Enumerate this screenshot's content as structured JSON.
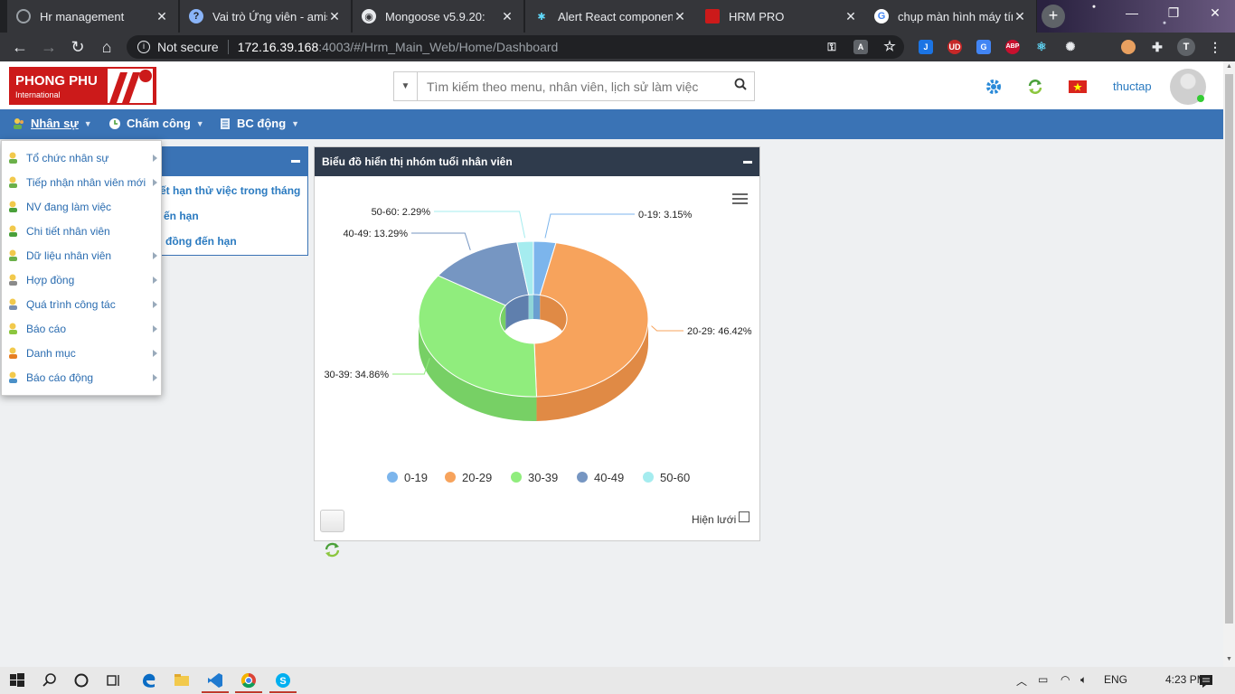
{
  "browser": {
    "tabs": [
      {
        "title": "Hr management",
        "icon": "loading-icon"
      },
      {
        "title": "Vai trò Ứng viên - amis",
        "icon": "help-icon"
      },
      {
        "title": "Mongoose v5.9.20:",
        "icon": "globe-icon"
      },
      {
        "title": "Alert React componen",
        "icon": "react-icon"
      },
      {
        "title": "HRM PRO",
        "icon": "hrm-icon"
      },
      {
        "title": "chụp màn hình máy tính",
        "icon": "google-icon"
      }
    ],
    "address": {
      "security": "Not secure",
      "host": "172.16.39.168",
      "path": ":4003/#/Hrm_Main_Web/Home/Dashboard"
    },
    "profile_initial": "T"
  },
  "app": {
    "logo": {
      "line1": "PHONG PHU",
      "line2": "International"
    },
    "search": {
      "placeholder": "Tìm kiếm theo menu, nhân viên, lịch sử làm việc"
    },
    "username": "thuctap",
    "nav": [
      {
        "label": "Nhân sự"
      },
      {
        "label": "Chấm công"
      },
      {
        "label": "BC động"
      }
    ],
    "menu": [
      {
        "label": "Tổ chức nhân sự",
        "submenu": true
      },
      {
        "label": "Tiếp nhận nhân viên mới",
        "submenu": true
      },
      {
        "label": "NV đang làm việc",
        "submenu": false
      },
      {
        "label": "Chi tiết nhân viên",
        "submenu": false
      },
      {
        "label": "Dữ liệu nhân viên",
        "submenu": true
      },
      {
        "label": "Hợp đồng",
        "submenu": true
      },
      {
        "label": "Quá trình công tác",
        "submenu": true
      },
      {
        "label": "Báo cáo",
        "submenu": true
      },
      {
        "label": "Danh mục",
        "submenu": true
      },
      {
        "label": "Báo cáo động",
        "submenu": true
      }
    ],
    "left_panel": {
      "links": [
        "ết hạn thử việc trong tháng",
        "ến hạn",
        "đồng đến hạn"
      ]
    },
    "chart_panel": {
      "title": "Biểu đồ hiển thị nhóm tuổi nhân viên",
      "grid_label": "Hiện lưới",
      "grid_checked": false
    }
  },
  "chart_data": {
    "type": "pie",
    "variant": "3d-donut",
    "title": "",
    "categories": [
      "0-19",
      "20-29",
      "30-39",
      "40-49",
      "50-60"
    ],
    "values": [
      3.15,
      46.42,
      34.86,
      13.29,
      2.29
    ],
    "data_labels": [
      "0-19: 3.15%",
      "20-29: 46.42%",
      "30-39: 34.86%",
      "40-49: 13.29%",
      "50-60: 2.29%"
    ],
    "colors": [
      "#7cb5ec",
      "#f7a35c",
      "#90ed7d",
      "#7696c2",
      "#a5ecef"
    ],
    "side_colors": [
      "#6a9fd0",
      "#e08a45",
      "#77d065",
      "#5f7fad",
      "#8fd5d8"
    ],
    "legend": [
      "0-19",
      "20-29",
      "30-39",
      "40-49",
      "50-60"
    ],
    "legend_position": "bottom"
  },
  "taskbar": {
    "lang": "ENG",
    "time": "4:23 PM"
  }
}
